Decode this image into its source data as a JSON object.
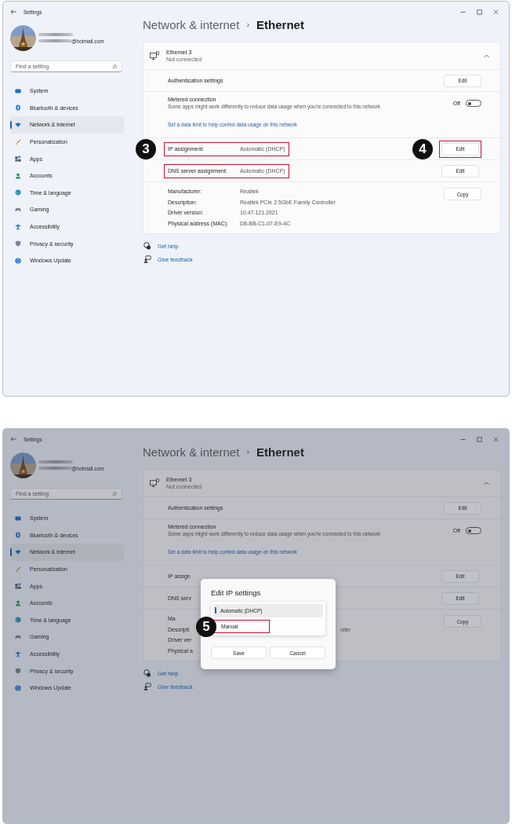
{
  "panels": [
    {
      "window": {
        "title": "Settings"
      },
      "account": {
        "email": "@hotmail.com"
      },
      "search": {
        "placeholder": "Find a setting"
      },
      "nav": [
        {
          "label": "System",
          "kind": "system",
          "selected": false
        },
        {
          "label": "Bluetooth & devices",
          "kind": "bluetooth",
          "selected": false
        },
        {
          "label": "Network & internet",
          "kind": "network",
          "selected": true
        },
        {
          "label": "Personalization",
          "kind": "personalization",
          "selected": false
        },
        {
          "label": "Apps",
          "kind": "apps",
          "selected": false
        },
        {
          "label": "Accounts",
          "kind": "accounts",
          "selected": false
        },
        {
          "label": "Time & language",
          "kind": "time",
          "selected": false
        },
        {
          "label": "Gaming",
          "kind": "gaming",
          "selected": false
        },
        {
          "label": "Accessibility",
          "kind": "accessibility",
          "selected": false
        },
        {
          "label": "Privacy & security",
          "kind": "privacy",
          "selected": false
        },
        {
          "label": "Windows Update",
          "kind": "update",
          "selected": false
        }
      ],
      "breadcrumb": {
        "parent": "Network & internet",
        "separator": "›",
        "current": "Ethernet"
      },
      "adapter": {
        "name": "Ethernet 3",
        "status": "Not connected",
        "expanded": true
      },
      "settings": [
        {
          "kind": "button",
          "label": "Authentication settings",
          "button": "Edit"
        },
        {
          "kind": "toggle",
          "label": "Metered connection",
          "description": "Some apps might work differently to reduce data usage when you're connected to this network",
          "state": "Off",
          "on": false,
          "link": "Set a data limit to help control data usage on this network"
        },
        {
          "kind": "assignment",
          "label": "IP assignment:",
          "value": "Automatic (DHCP)",
          "highlighted": true,
          "callout": "3",
          "button": "Edit",
          "button_highlighted": true,
          "button_callout": "4"
        },
        {
          "kind": "assignment",
          "label": "DNS server assignment:",
          "value": "Automatic (DHCP)",
          "highlighted": true,
          "button": "Edit",
          "button_highlighted": false
        },
        {
          "kind": "properties",
          "button": "Copy",
          "properties": [
            {
              "label": "Manufacturer:",
              "value": "Realtek"
            },
            {
              "label": "Description:",
              "value": "Realtek PCIe 2.5GbE Family Controller"
            },
            {
              "label": "Driver version:",
              "value": "10.47.121.2021"
            },
            {
              "label": "Physical address (MAC):",
              "value": "D8-BB-C1-07-E9-4C"
            }
          ]
        }
      ],
      "help_links": [
        {
          "kind": "help",
          "label": "Get help"
        },
        {
          "kind": "feedback",
          "label": "Give feedback"
        }
      ],
      "dimmed": false
    },
    {
      "window": {
        "title": "Settings"
      },
      "account": {
        "email": "@hotmail.com"
      },
      "search": {
        "placeholder": "Find a setting"
      },
      "nav": [
        {
          "label": "System",
          "kind": "system",
          "selected": false
        },
        {
          "label": "Bluetooth & devices",
          "kind": "bluetooth",
          "selected": false
        },
        {
          "label": "Network & internet",
          "kind": "network",
          "selected": true
        },
        {
          "label": "Personalization",
          "kind": "personalization",
          "selected": false
        },
        {
          "label": "Apps",
          "kind": "apps",
          "selected": false
        },
        {
          "label": "Accounts",
          "kind": "accounts",
          "selected": false
        },
        {
          "label": "Time & language",
          "kind": "time",
          "selected": false
        },
        {
          "label": "Gaming",
          "kind": "gaming",
          "selected": false
        },
        {
          "label": "Accessibility",
          "kind": "accessibility",
          "selected": false
        },
        {
          "label": "Privacy & security",
          "kind": "privacy",
          "selected": false
        },
        {
          "label": "Windows Update",
          "kind": "update",
          "selected": false
        }
      ],
      "breadcrumb": {
        "parent": "Network & internet",
        "separator": "›",
        "current": "Ethernet"
      },
      "adapter": {
        "name": "Ethernet 3",
        "status": "Not connected",
        "expanded": true
      },
      "settings": [
        {
          "kind": "button",
          "label": "Authentication settings",
          "button": "Edit"
        },
        {
          "kind": "toggle",
          "label": "Metered connection",
          "description": "Some apps might work differently to reduce data usage when you're connected to this network",
          "state": "Off",
          "on": false,
          "link": "Set a data limit to help control data usage on this network"
        },
        {
          "kind": "assignment",
          "label": "IP assign",
          "highlighted": false,
          "button": "Edit",
          "button_highlighted": false
        },
        {
          "kind": "assignment",
          "label": "DNS serv",
          "highlighted": false,
          "button": "Edit",
          "button_highlighted": false
        },
        {
          "kind": "properties",
          "button": "Copy",
          "properties": [
            {
              "label": "Ma"
            },
            {
              "label": "Descripti",
              "value": "oller"
            },
            {
              "label": "Driver ver"
            },
            {
              "label": "Physical a"
            }
          ]
        }
      ],
      "help_links": [
        {
          "kind": "help",
          "label": "Get help"
        },
        {
          "kind": "feedback",
          "label": "Give feedback"
        }
      ],
      "dimmed": true,
      "dialog": {
        "title": "Edit IP settings",
        "options": [
          {
            "label": "Automatic (DHCP)",
            "selected": true,
            "highlighted": false
          },
          {
            "label": "Manual",
            "selected": false,
            "highlighted": true,
            "callout": "5"
          }
        ],
        "buttons": [
          "Save",
          "Cancel"
        ]
      }
    }
  ]
}
